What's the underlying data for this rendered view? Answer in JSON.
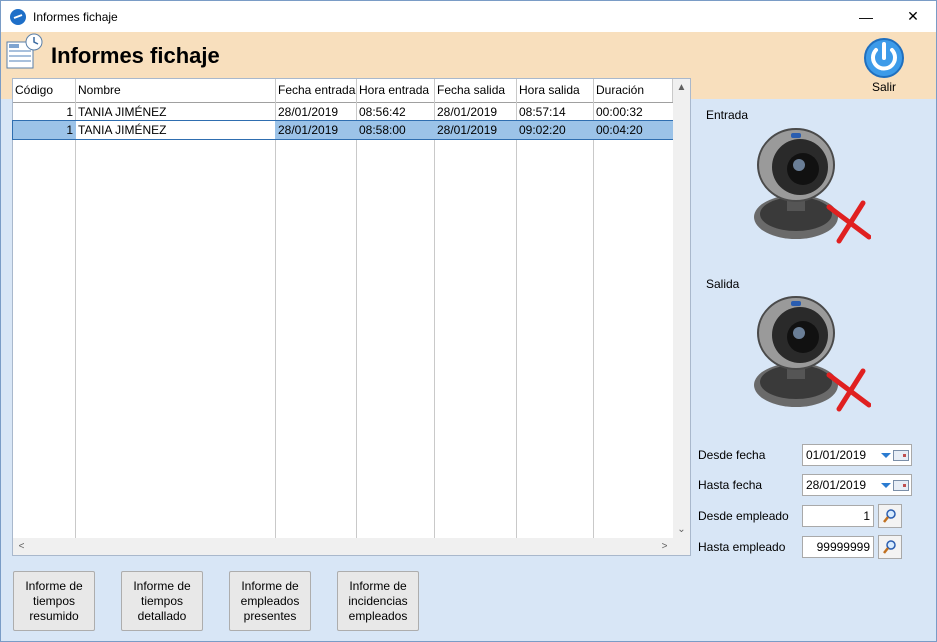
{
  "window": {
    "title": "Informes fichaje",
    "minimize_glyph": "—",
    "close_glyph": "✕"
  },
  "header": {
    "title": "Informes fichaje",
    "icon": "report-icon",
    "exit_label": "Salir",
    "exit_icon": "power-icon"
  },
  "table": {
    "columns": [
      "Código",
      "Nombre",
      "Fecha entrada",
      "Hora entrada",
      "Fecha salida",
      "Hora salida",
      "Duración"
    ],
    "rows": [
      {
        "codigo": "1",
        "nombre": "TANIA JIMÉNEZ",
        "fecha_entrada": "28/01/2019",
        "hora_entrada": "08:56:42",
        "fecha_salida": "28/01/2019",
        "hora_salida": "08:57:14",
        "duracion": "00:00:32",
        "selected": false
      },
      {
        "codigo": "1",
        "nombre": "TANIA JIMÉNEZ",
        "fecha_entrada": "28/01/2019",
        "hora_entrada": "08:58:00",
        "fecha_salida": "28/01/2019",
        "hora_salida": "09:02:20",
        "duracion": "00:04:20",
        "selected": true
      }
    ],
    "scroll_up": "▲",
    "scroll_down": "⌄",
    "scroll_left": "<",
    "scroll_right": ">"
  },
  "side": {
    "entrada_label": "Entrada",
    "salida_label": "Salida",
    "camera_icon": "webcam-icon",
    "status_icon": "red-x-icon"
  },
  "filters": {
    "desde_fecha_label": "Desde fecha",
    "desde_fecha_value": "01/01/2019",
    "hasta_fecha_label": "Hasta fecha",
    "hasta_fecha_value": "28/01/2019",
    "desde_empleado_label": "Desde empleado",
    "desde_empleado_value": "1",
    "hasta_empleado_label": "Hasta empleado",
    "hasta_empleado_value": "99999999"
  },
  "buttons": {
    "resumido": "Informe de\ntiempos\nresumido",
    "detallado": "Informe de\ntiempos\ndetallado",
    "presentes": "Informe de\nempleados\npresentes",
    "incidencias": "Informe de\nincidencias\nempleados"
  },
  "colors": {
    "header_bg": "#f8dfbd",
    "body_bg": "#d8e6f6",
    "selection": "#9cc3e8",
    "accent": "#1e6fc8"
  }
}
